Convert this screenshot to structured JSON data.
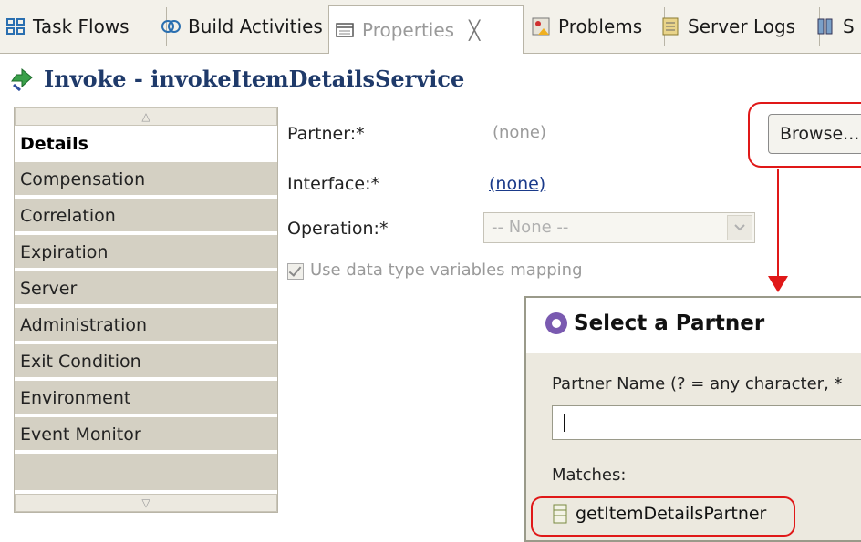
{
  "tabs": [
    {
      "label": "Task Flows",
      "icon": "task-flows-icon"
    },
    {
      "label": "Build Activities",
      "icon": "build-activities-icon"
    },
    {
      "label": "Properties",
      "icon": "properties-icon",
      "close": "╳"
    },
    {
      "label": "Problems",
      "icon": "problems-icon"
    },
    {
      "label": "Server Logs",
      "icon": "server-logs-icon"
    },
    {
      "label": "S",
      "icon": "server-icon"
    }
  ],
  "title": "Invoke - invokeItemDetailsService",
  "left_tabs": [
    "Details",
    "Compensation",
    "Correlation",
    "Expiration",
    "Server",
    "Administration",
    "Exit Condition",
    "Environment",
    "Event Monitor"
  ],
  "form": {
    "partner_label": "Partner:*",
    "partner_value": "(none)",
    "interface_label": "Interface:*",
    "interface_value": "(none)",
    "operation_label": "Operation:*",
    "operation_value": "-- None --",
    "mapping_label": "Use data type variables mapping",
    "mapping_checked": true,
    "browse_label": "Browse..."
  },
  "dialog": {
    "title": "Select a Partner",
    "name_label": "Partner Name (? = any character, *",
    "name_value": "",
    "matches_label": "Matches:",
    "match_item": "getItemDetailsPartner"
  },
  "colors": {
    "highlight": "#e01818",
    "title": "#1f3a6a",
    "tab_bg": "#d4d0c3"
  }
}
